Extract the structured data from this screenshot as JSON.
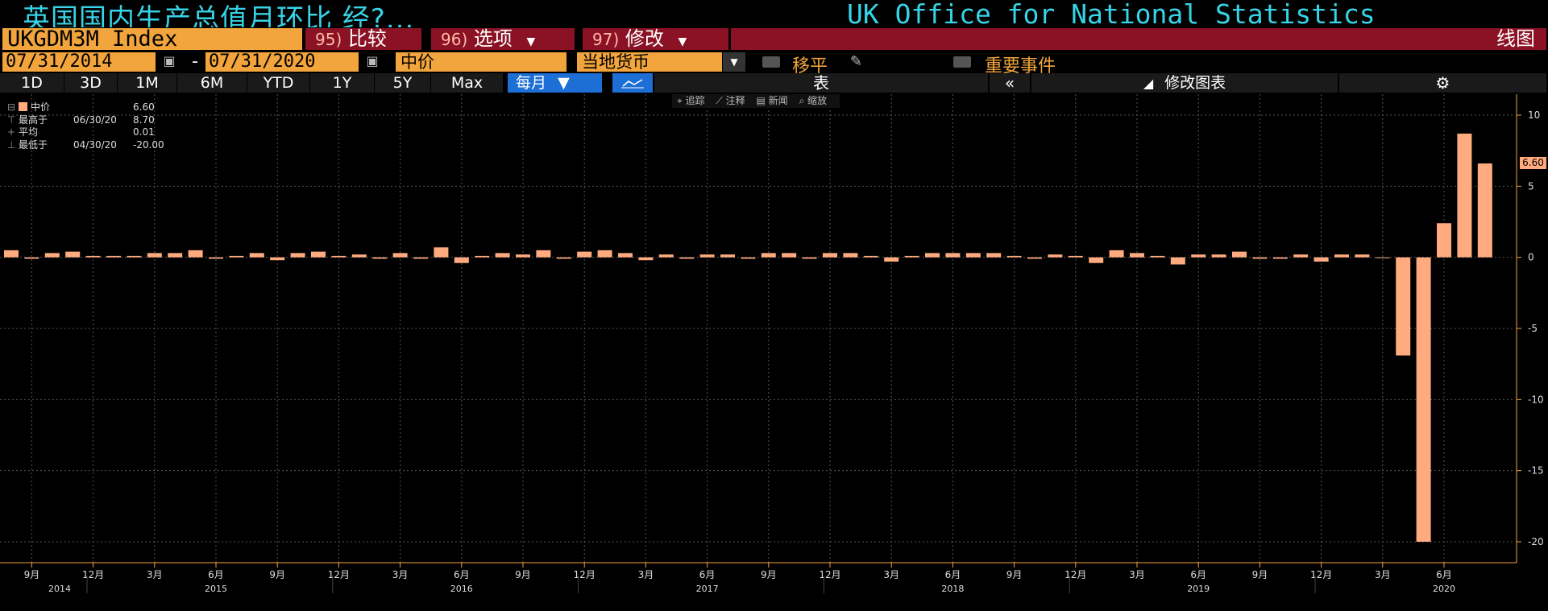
{
  "title": {
    "left": "英国国内生产总值月环比 经?...",
    "right": "UK Office for National Statistics"
  },
  "ticker": "UKGDM3M Index",
  "menu": {
    "compare": {
      "num": "95)",
      "label": "比较"
    },
    "options": {
      "num": "96)",
      "label": "选项"
    },
    "edit": {
      "num": "97)",
      "label": "修改"
    },
    "chart_type": "线图"
  },
  "dates": {
    "start": "07/31/2014",
    "dash": "-",
    "end": "07/31/2020"
  },
  "price_field": "中价",
  "currency": "当地货币",
  "move_flat_label": "移平",
  "events_label": "重要事件",
  "periods": [
    "1D",
    "3D",
    "1M",
    "6M",
    "YTD",
    "1Y",
    "5Y",
    "Max"
  ],
  "frequency": "每月",
  "table_label": "表",
  "collapse_label": "«",
  "edit_chart_label": "修改图表",
  "mini_toolbar": [
    "⌖ 追踪",
    "⟋ 注释",
    "▤ 新闻",
    "⌕ 缩放"
  ],
  "legend": {
    "series": {
      "label": "中价",
      "value": "6.60"
    },
    "high": {
      "label": "最高于",
      "date": "06/30/20",
      "value": "8.70"
    },
    "avg": {
      "label": "平均",
      "value": "0.01"
    },
    "low": {
      "label": "最低于",
      "date": "04/30/20",
      "value": "-20.00"
    }
  },
  "last_value_tag": "6.60",
  "colors": {
    "bar": "#ffaa7f",
    "accent": "#f2a53c",
    "title": "#37d3e6",
    "menu": "#8a1224",
    "grid": "#555555"
  },
  "chart_data": {
    "type": "bar",
    "x_start": "2014-08",
    "x_end": "2020-07",
    "ylim": [
      -22,
      11
    ],
    "yticks": [
      10,
      5,
      0,
      -5,
      -10,
      -15,
      -20
    ],
    "values": [
      0.5,
      -0.1,
      0.3,
      0.4,
      0.1,
      0.1,
      0.1,
      0.3,
      0.3,
      0.5,
      -0.1,
      0.1,
      0.3,
      -0.2,
      0.3,
      0.4,
      0.1,
      0.2,
      -0.1,
      0.3,
      -0.1,
      0.7,
      -0.4,
      0.1,
      0.3,
      0.2,
      0.5,
      -0.1,
      0.4,
      0.5,
      0.3,
      -0.2,
      0.2,
      -0.1,
      0.2,
      0.2,
      -0.1,
      0.3,
      0.3,
      -0.1,
      0.3,
      0.3,
      0.1,
      -0.3,
      0.1,
      0.3,
      0.3,
      0.3,
      0.3,
      0.1,
      -0.1,
      0.2,
      0.1,
      -0.4,
      0.5,
      0.3,
      0.1,
      -0.5,
      0.2,
      0.2,
      0.4,
      -0.1,
      -0.1,
      0.2,
      -0.3,
      0.2,
      0.2,
      0.0,
      -6.9,
      -20.0,
      2.4,
      8.7,
      6.6
    ],
    "x_tick_labels": [
      {
        "month": 1,
        "label": "9月"
      },
      {
        "month": 4,
        "label": "12月"
      },
      {
        "month": 7,
        "label": "3月"
      },
      {
        "month": 10,
        "label": "6月"
      },
      {
        "month": 13,
        "label": "9月"
      },
      {
        "month": 16,
        "label": "12月"
      },
      {
        "month": 19,
        "label": "3月"
      },
      {
        "month": 22,
        "label": "6月"
      },
      {
        "month": 25,
        "label": "9月"
      },
      {
        "month": 28,
        "label": "12月"
      },
      {
        "month": 31,
        "label": "3月"
      },
      {
        "month": 34,
        "label": "6月"
      },
      {
        "month": 37,
        "label": "9月"
      },
      {
        "month": 40,
        "label": "12月"
      },
      {
        "month": 43,
        "label": "3月"
      },
      {
        "month": 46,
        "label": "6月"
      },
      {
        "month": 49,
        "label": "9月"
      },
      {
        "month": 52,
        "label": "12月"
      },
      {
        "month": 55,
        "label": "3月"
      },
      {
        "month": 58,
        "label": "6月"
      },
      {
        "month": 61,
        "label": "9月"
      },
      {
        "month": 64,
        "label": "12月"
      },
      {
        "month": 67,
        "label": "3月"
      },
      {
        "month": 70,
        "label": "6月"
      }
    ],
    "year_labels": [
      {
        "month": 0,
        "label": "2014"
      },
      {
        "month": 10,
        "label": "2015"
      },
      {
        "month": 22,
        "label": "2016"
      },
      {
        "month": 34,
        "label": "2017"
      },
      {
        "month": 46,
        "label": "2018"
      },
      {
        "month": 58,
        "label": "2019"
      },
      {
        "month": 70,
        "label": "2020"
      }
    ],
    "grid": true
  }
}
